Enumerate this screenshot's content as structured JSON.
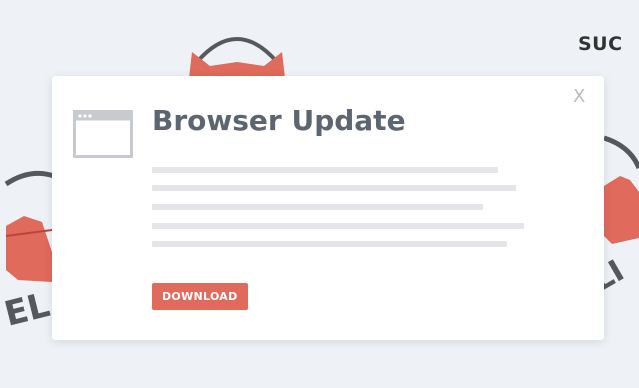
{
  "brand": {
    "text": "SUC"
  },
  "popup": {
    "title": "Browser Update",
    "close_label": "X",
    "download_label": "DOWNLOAD",
    "icon": "browser-window-icon"
  },
  "background": {
    "decoration": "padlock-mascot-icons"
  },
  "colors": {
    "accent": "#e06a5c",
    "background": "#eef2f6",
    "title": "#5d6670",
    "placeholder_line": "#e3e5e8",
    "close": "#b7bcc2"
  }
}
